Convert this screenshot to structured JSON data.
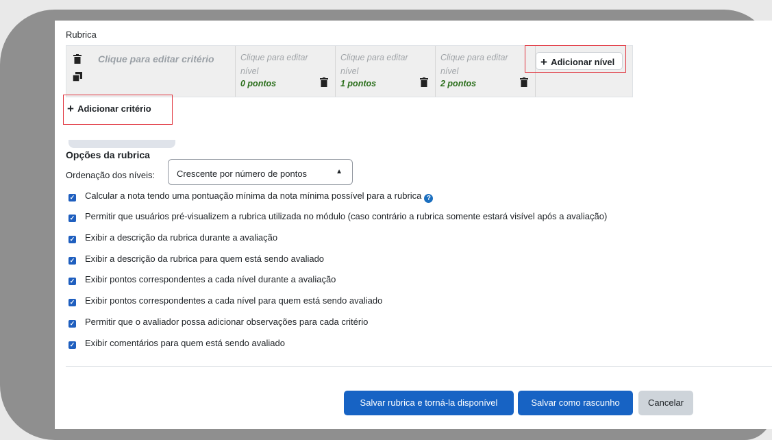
{
  "section_title": "Rubrica",
  "criterion": {
    "placeholder": "Clique para editar critério",
    "delete_icon": "trash-icon",
    "duplicate_icon": "duplicate-icon"
  },
  "levels": [
    {
      "text": "Clique para editar nível",
      "points": "0 pontos"
    },
    {
      "text": "Clique para editar nível",
      "points": "1 pontos"
    },
    {
      "text": "Clique para editar nível",
      "points": "2 pontos"
    }
  ],
  "add_level_label": "Adicionar nível",
  "add_criterion_label": "Adicionar critério",
  "plus_symbol": "+",
  "options": {
    "title": "Opções da rubrica",
    "sort_label": "Ordenação dos níveis:",
    "sort_value": "Crescente por número de pontos",
    "checkboxes": [
      {
        "label": "Calcular a nota tendo uma pontuação mínima da nota mínima possível para a rubrica",
        "checked": true,
        "help": true
      },
      {
        "label": "Permitir que usuários pré-visualizem a rubrica utilizada no módulo (caso contrário a rubrica somente estará visível após a avaliação)",
        "checked": true
      },
      {
        "label": "Exibir a descrição da rubrica durante a avaliação",
        "checked": true
      },
      {
        "label": "Exibir a descrição da rubrica para quem está sendo avaliado",
        "checked": true
      },
      {
        "label": "Exibir pontos correspondentes a cada nível durante a avaliação",
        "checked": true
      },
      {
        "label": "Exibir pontos correspondentes a cada nível para quem está sendo avaliado",
        "checked": true
      },
      {
        "label": "Permitir que o avaliador possa adicionar observações para cada critério",
        "checked": true
      },
      {
        "label": "Exibir comentários para quem está sendo avaliado",
        "checked": true
      }
    ]
  },
  "buttons": {
    "save_available": "Salvar rubrica e torná-la disponível",
    "save_draft": "Salvar como rascunho",
    "cancel": "Cancelar"
  },
  "colors": {
    "primary": "#1763c4",
    "highlight_box": "#e0313b",
    "points_text": "#2a6e1a"
  }
}
